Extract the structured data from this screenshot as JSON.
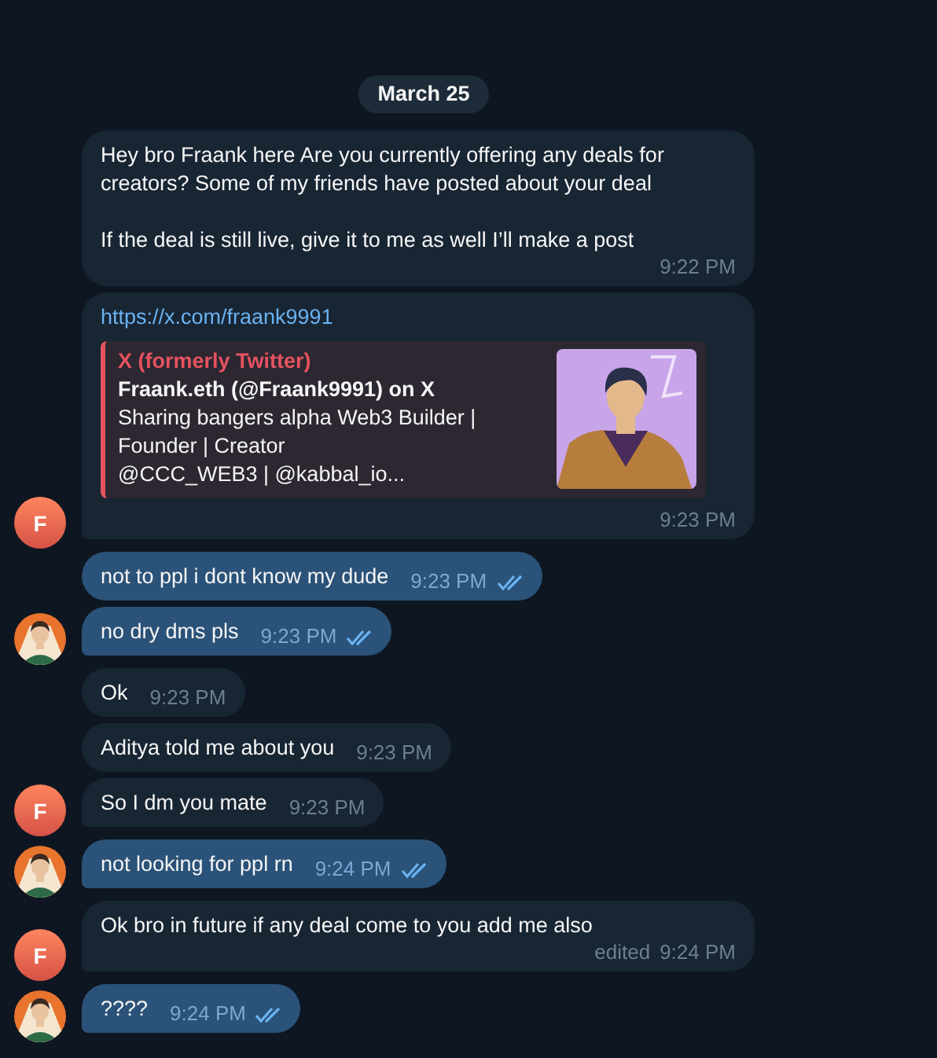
{
  "date": "March 25",
  "groups": [
    {
      "kind": "incoming",
      "avatar": {
        "kind": "letter",
        "text": "F"
      },
      "messages": [
        {
          "kind": "text",
          "text": "Hey bro Fraank here Are you currently offering any deals for creators? Some of my friends have posted about your deal\n\nIf the deal is still live, give it to me as well I’ll make a post",
          "time": "9:22 PM"
        },
        {
          "kind": "link",
          "link": "https://x.com/fraank9991",
          "preview": {
            "site": "X (formerly Twitter)",
            "title": "Fraank.eth (@Fraank9991) on X",
            "description": "Sharing bangers alpha Web3 Builder | Founder | Creator\n@CCC_WEB3 | @kabbal_io..."
          },
          "time": "9:23 PM"
        }
      ]
    },
    {
      "kind": "outgoing",
      "avatar": {
        "kind": "picture"
      },
      "messages": [
        {
          "kind": "text",
          "text": "not to ppl i dont know my dude",
          "time": "9:23 PM",
          "read": true
        },
        {
          "kind": "text",
          "text": "no dry dms pls",
          "time": "9:23 PM",
          "read": true
        }
      ]
    },
    {
      "kind": "incoming",
      "avatar": {
        "kind": "letter",
        "text": "F"
      },
      "messages": [
        {
          "kind": "text",
          "text": "Ok",
          "time": "9:23 PM"
        },
        {
          "kind": "text",
          "text": "Aditya told me about you",
          "time": "9:23 PM"
        },
        {
          "kind": "text",
          "text": "So I dm you mate",
          "time": "9:23 PM"
        }
      ]
    },
    {
      "kind": "outgoing",
      "avatar": {
        "kind": "picture"
      },
      "messages": [
        {
          "kind": "text",
          "text": "not looking for ppl rn",
          "time": "9:24 PM",
          "read": true
        }
      ]
    },
    {
      "kind": "incoming",
      "avatar": {
        "kind": "letter",
        "text": "F"
      },
      "messages": [
        {
          "kind": "text",
          "text": "Ok bro in future if any deal come to you add me also",
          "time": "9:24 PM",
          "edited": "edited"
        }
      ]
    },
    {
      "kind": "outgoing",
      "avatar": {
        "kind": "picture"
      },
      "messages": [
        {
          "kind": "text",
          "text": "????",
          "time": "9:24 PM",
          "read": true
        }
      ]
    }
  ]
}
